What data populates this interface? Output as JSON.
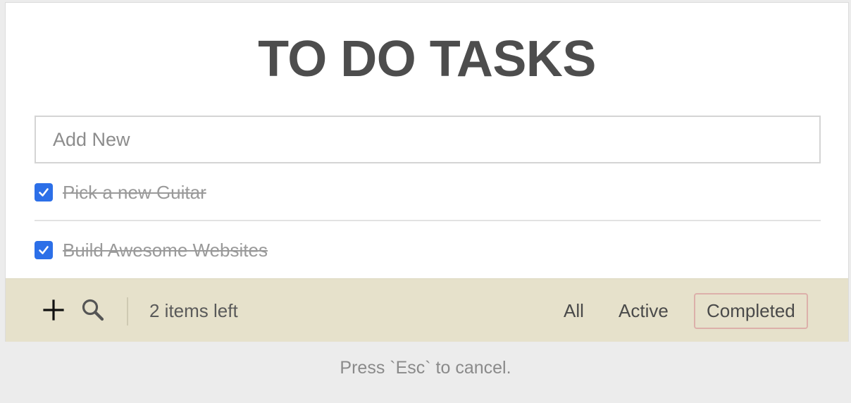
{
  "header": {
    "title": "TO DO TASKS"
  },
  "new_task": {
    "placeholder": "Add New",
    "value": ""
  },
  "tasks": [
    {
      "text": "Pick a new Guitar",
      "completed": true
    },
    {
      "text": "Build Awesome Websites",
      "completed": true
    }
  ],
  "footer": {
    "add_icon": "plus-icon",
    "search_icon": "search-icon",
    "items_left": "2 items left",
    "filters": [
      {
        "label": "All",
        "selected": false
      },
      {
        "label": "Active",
        "selected": false
      },
      {
        "label": "Completed",
        "selected": true
      }
    ]
  },
  "hint": "Press `Esc` to cancel.",
  "colors": {
    "checkbox": "#2c6fe8",
    "footer_bg": "#e6e1cb",
    "selected_filter_border": "#dcb0aa",
    "title": "#4d4d4d"
  }
}
